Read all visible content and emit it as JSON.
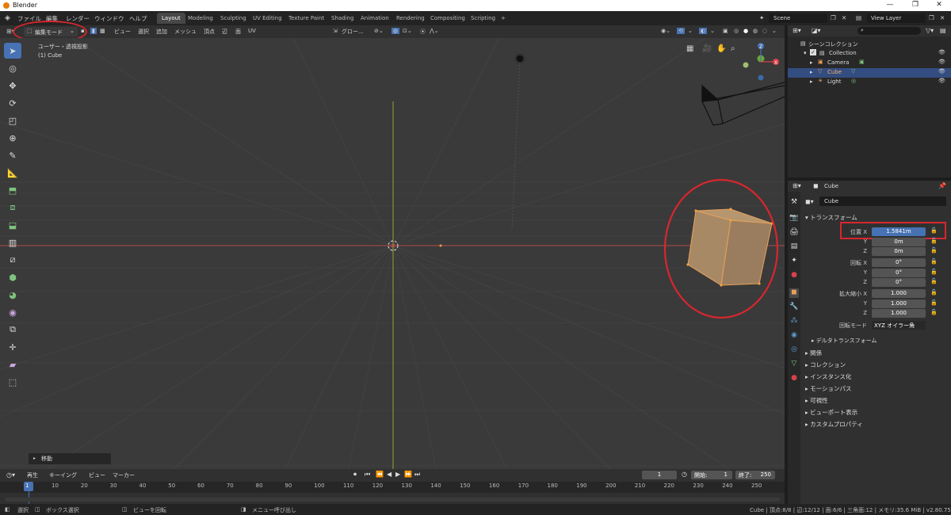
{
  "window": {
    "title": "Blender",
    "minimize": "—",
    "maximize": "❐",
    "close": "✕"
  },
  "menus": [
    "ファイル",
    "編集",
    "レンダー",
    "ウィンドウ",
    "ヘルプ"
  ],
  "workspaces": [
    "Layout",
    "Modeling",
    "Sculpting",
    "UV Editing",
    "Texture Paint",
    "Shading",
    "Animation",
    "Rendering",
    "Compositing",
    "Scripting",
    "+"
  ],
  "scene": {
    "label": "Scene",
    "view_layer": "View Layer"
  },
  "viewport_header": {
    "mode": "編集モード",
    "menus": [
      "ビュー",
      "選択",
      "追加",
      "メッシュ",
      "頂点",
      "辺",
      "面",
      "UV"
    ],
    "orientation": "グロー..."
  },
  "viewport": {
    "view_name": "ユーザー・透視投影",
    "object_info": "(1) Cube",
    "last_op": "移動"
  },
  "outliner": {
    "title": "シーンコレクション",
    "collection": "Collection",
    "items": [
      "Camera",
      "Cube",
      "Light"
    ]
  },
  "properties": {
    "object_name": "Cube",
    "object_field": "Cube",
    "transform_header": "トランスフォーム",
    "location_label": "位置 X",
    "location": [
      "1.5841m",
      "0m",
      "0m"
    ],
    "rotation_label": "回転 X",
    "rotation": [
      "0°",
      "0°",
      "0°"
    ],
    "scale_label": "拡大縮小 X",
    "scale": [
      "1.000",
      "1.000",
      "1.000"
    ],
    "axis_y": "Y",
    "axis_z": "Z",
    "rotation_mode_label": "回転モード",
    "rotation_mode": "XYZ オイラー角",
    "delta": "デルタトランスフォーム",
    "sections": [
      "関係",
      "コレクション",
      "インスタンス化",
      "モーションパス",
      "可視性",
      "ビューポート表示",
      "カスタムプロパティ"
    ]
  },
  "timeline": {
    "menus": [
      "再生",
      "キーイング",
      "ビュー",
      "マーカー"
    ],
    "current_frame": "1",
    "start_label": "開始:",
    "start": "1",
    "end_label": "終了:",
    "end": "250",
    "ticks": [
      "1",
      "10",
      "20",
      "30",
      "40",
      "50",
      "60",
      "70",
      "80",
      "90",
      "100",
      "110",
      "120",
      "130",
      "140",
      "150",
      "160",
      "170",
      "180",
      "190",
      "200",
      "210",
      "220",
      "230",
      "240",
      "250"
    ]
  },
  "status": {
    "select": "選択",
    "box_select": "ボックス選択",
    "rotate_view": "ビューを回転",
    "menu_call": "メニュー呼び出し",
    "stats": "Cube | 頂点:8/8 | 辺:12/12 | 面:6/6 | 三角面:12 | メモリ:35.6 MiB | v2.80.75"
  },
  "colors": {
    "accent": "#4772b3",
    "highlight": "#d8262e",
    "object": "#e8a05a"
  }
}
